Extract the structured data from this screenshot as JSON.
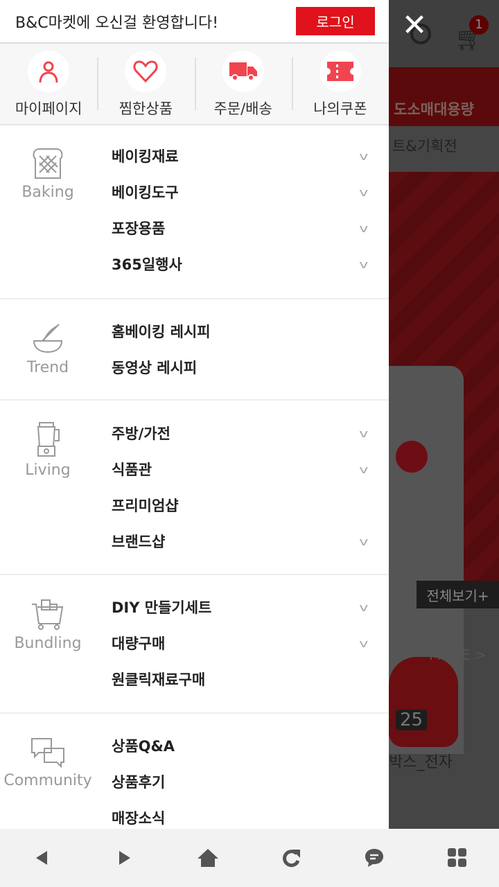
{
  "header": {
    "welcome": "B&C마켓에 오신걸 환영합니다!",
    "login_label": "로그인"
  },
  "quick": [
    {
      "label": "마이페이지",
      "icon": "person-icon"
    },
    {
      "label": "찜한상품",
      "icon": "heart-icon"
    },
    {
      "label": "주문/배송",
      "icon": "truck-icon"
    },
    {
      "label": "나의쿠폰",
      "icon": "coupon-icon"
    }
  ],
  "sections": [
    {
      "label": "Baking",
      "icon": "bread-icon",
      "items": [
        {
          "label": "베이킹재료",
          "expandable": true
        },
        {
          "label": "베이킹도구",
          "expandable": true
        },
        {
          "label": "포장용품",
          "expandable": true
        },
        {
          "label": "365일행사",
          "expandable": true
        }
      ]
    },
    {
      "label": "Trend",
      "icon": "whisk-bowl-icon",
      "items": [
        {
          "label": "홈베이킹 레시피",
          "expandable": false
        },
        {
          "label": "동영상 레시피",
          "expandable": false
        }
      ]
    },
    {
      "label": "Living",
      "icon": "blender-icon",
      "items": [
        {
          "label": "주방/가전",
          "expandable": true
        },
        {
          "label": "식품관",
          "expandable": true
        },
        {
          "label": "프리미엄샵",
          "expandable": false
        },
        {
          "label": "브랜드샵",
          "expandable": true
        }
      ]
    },
    {
      "label": "Bundling",
      "icon": "cart-box-icon",
      "items": [
        {
          "label": "DIY 만들기세트",
          "expandable": true
        },
        {
          "label": "대량구매",
          "expandable": true
        },
        {
          "label": "원클릭재료구매",
          "expandable": false
        }
      ]
    },
    {
      "label": "Community",
      "icon": "chat-bubbles-icon",
      "items": [
        {
          "label": "상품Q&A",
          "expandable": false
        },
        {
          "label": "상품후기",
          "expandable": false
        },
        {
          "label": "매장소식",
          "expandable": false
        }
      ]
    }
  ],
  "background": {
    "wholesale": "도소매대용량",
    "event": "트&기획전",
    "view_all": "전체보기+",
    "more": "MORE >",
    "count_prefix": ":",
    "count": "25",
    "product": "박스_전자",
    "cart_count": "1"
  },
  "colors": {
    "accent": "#e0121b",
    "icon": "#f0454f"
  }
}
